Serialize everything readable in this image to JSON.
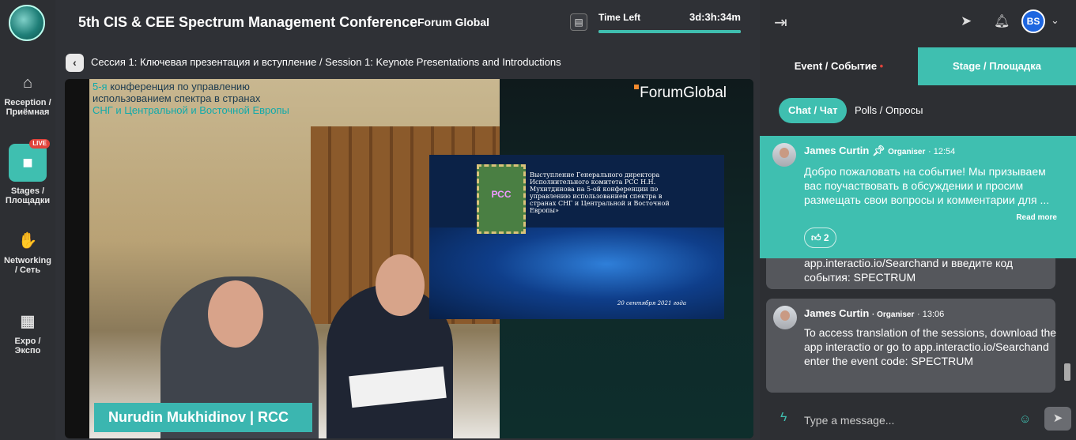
{
  "app": {
    "title": "5th CIS & CEE Spectrum Management Conference",
    "organizer": "Forum Global"
  },
  "timer": {
    "label": "Time Left",
    "value": "3d:3h:34m",
    "progress": 1.0
  },
  "sidebar": {
    "items": [
      {
        "label": "Reception / Приёмная",
        "icon": "home-icon"
      },
      {
        "label": "Stages / Площадки",
        "icon": "camera-icon",
        "badge": "LIVE"
      },
      {
        "label": "Networking / Сеть",
        "icon": "handshake-icon"
      },
      {
        "label": "Expo / Экспо",
        "icon": "store-icon"
      }
    ]
  },
  "session": {
    "title": "Сессия 1: Ключевая презентация и вступление / Session 1: Keynote Presentations and Introductions"
  },
  "video": {
    "overlay_line1_hl": "5-я",
    "overlay_line1": " конференция по управлению",
    "overlay_line2": "использованием спектра в странах",
    "overlay_line3": "СНГ и Центральной и Восточной Европы",
    "brand": "ForumGlobal",
    "slide_text": "Выступление Генерального директора Исполнительного комитета РСС Н.Н. Мухитдинова на 5-ой конференции по управлению использованием спектра в странах СНГ и Центральной и Восточной Европы»",
    "slide_date": "20 сентября 2021 года",
    "stamp_label": "РСС",
    "speaker": "Nurudin Mukhidinov | RCC"
  },
  "right_panel": {
    "avatar_initials": "BS",
    "tabs": {
      "event": "Event / Событие",
      "stage": "Stage / Площадка"
    },
    "subtabs": {
      "chat": "Chat / Чат",
      "polls": "Polls / Опросы"
    },
    "pinned": {
      "name": "James Curtin",
      "role": "Organiser",
      "time": "12:54",
      "text": "Добро пожаловать на событие! Мы призываем вас поучаствовать в обсуждении и просим размещать свои вопросы и комментарии для ...",
      "read_more": "Read more",
      "likes": "2"
    },
    "messages": [
      {
        "text": "app.interactio.io/Searchand и введите код события: SPECTRUM"
      },
      {
        "name": "James Curtin",
        "role": "Organiser",
        "time": "13:06",
        "text": "To access translation of the sessions, download the app interactio or go to app.interactio.io/Searchand enter the event code: SPECTRUM"
      }
    ],
    "input_placeholder": "Type a message..."
  }
}
